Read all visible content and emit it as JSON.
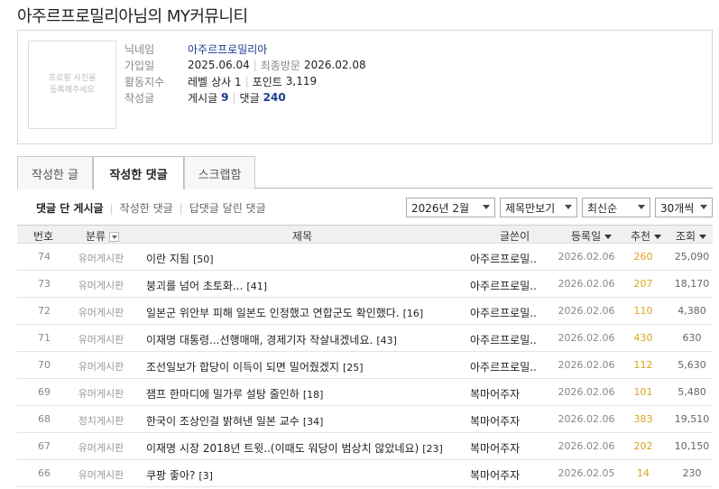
{
  "header": {
    "title": "아주르프로밀리아님의 MY커뮤니티"
  },
  "profile": {
    "photo_text": "프로필 사진을\n등록해주세요",
    "nickname_label": "닉네임",
    "nickname": "아주르프로밀리아",
    "join_label": "가입일",
    "join_date": "2025.06.04",
    "last_visit_label": "최종방문",
    "last_visit": "2026.02.08",
    "activity_label": "활동지수",
    "level_label": "레벨",
    "level_value": "상사 1",
    "point_label": "포인트",
    "point_value": "3,119",
    "posts_label": "작성글",
    "post_count_label": "게시글",
    "post_count": "9",
    "comment_count_label": "댓글",
    "comment_count": "240"
  },
  "tabs": [
    "작성한 글",
    "작성한 댓글",
    "스크랩함"
  ],
  "subnav": [
    "댓글 단 게시글",
    "작성한 댓글",
    "답댓글 달린 댓글"
  ],
  "filters": {
    "month": "2026년 2월",
    "view_mode": "제목만보기",
    "sort": "최신순",
    "per_page": "30개씩"
  },
  "columns": {
    "no": "번호",
    "category": "분류",
    "title": "제목",
    "author": "글쓴이",
    "date": "등록일",
    "recommend": "추천",
    "views": "조회"
  },
  "rows": [
    {
      "no": "74",
      "category": "유머게시판",
      "title": "이란 지됨",
      "comments": "[50]",
      "author": "아주르프로밀..",
      "date": "2026.02.06",
      "recommend": "260",
      "views": "25,090"
    },
    {
      "no": "73",
      "category": "유머게시판",
      "title": "붕괴를 넘어 초토화...",
      "comments": "[41]",
      "author": "아주르프로밀..",
      "date": "2026.02.06",
      "recommend": "207",
      "views": "18,170"
    },
    {
      "no": "72",
      "category": "유머게시판",
      "title": "일본군 위안부 피해 일본도 인정했고 연합군도 확인했다.",
      "comments": "[16]",
      "author": "아주르프로밀..",
      "date": "2026.02.06",
      "recommend": "110",
      "views": "4,380"
    },
    {
      "no": "71",
      "category": "유머게시판",
      "title": "이재명 대통령...선행매매, 경제기자 작살내겠네요.",
      "comments": "[43]",
      "author": "아주르프로밀..",
      "date": "2026.02.06",
      "recommend": "430",
      "views": "630"
    },
    {
      "no": "70",
      "category": "유머게시판",
      "title": "조선일보가 합당이 이득이 되면 밀어줬겠지",
      "comments": "[25]",
      "author": "아주르프로밀..",
      "date": "2026.02.06",
      "recommend": "112",
      "views": "5,630"
    },
    {
      "no": "69",
      "category": "유머게시판",
      "title": "잼프 한마디에 밀가루 설탕 줄인하",
      "comments": "[18]",
      "author": "복마어주자",
      "date": "2026.02.06",
      "recommend": "101",
      "views": "5,480"
    },
    {
      "no": "68",
      "category": "정치게시판",
      "title": "한국이 조상인걸 밝혀낸 일본 교수",
      "comments": "[34]",
      "author": "복마어주자",
      "date": "2026.02.06",
      "recommend": "383",
      "views": "19,510"
    },
    {
      "no": "67",
      "category": "유머게시판",
      "title": "이재명 시장 2018년 트윗..(이때도 워당이 범상치 않았네요)",
      "comments": "[23]",
      "author": "복마어주자",
      "date": "2026.02.06",
      "recommend": "202",
      "views": "10,150"
    },
    {
      "no": "66",
      "category": "유머게시판",
      "title": "쿠팡 좋아?",
      "comments": "[3]",
      "author": "복마어주자",
      "date": "2026.02.05",
      "recommend": "14",
      "views": "230"
    }
  ]
}
